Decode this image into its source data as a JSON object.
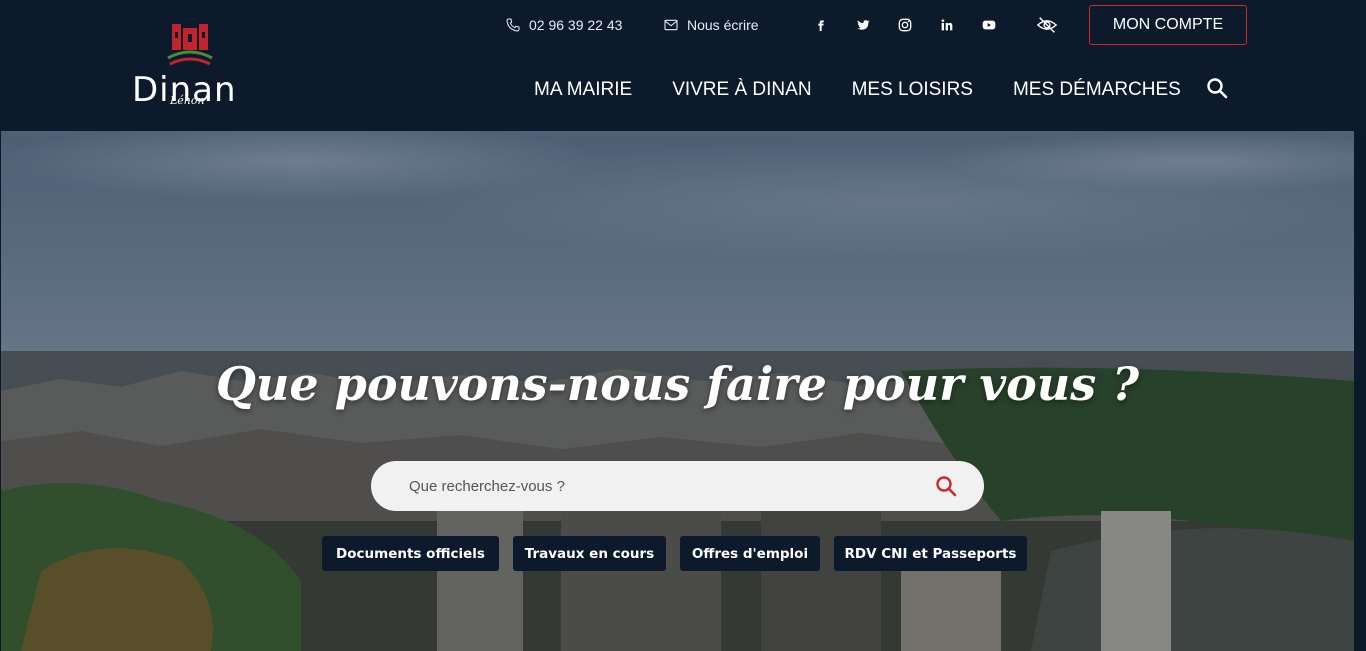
{
  "header": {
    "logo": {
      "name": "Dinan",
      "subtitle": "Léhon"
    },
    "phone": "02 96 39 22 43",
    "contact_label": "Nous écrire",
    "socials": [
      "facebook-icon",
      "twitter-icon",
      "instagram-icon",
      "linkedin-icon",
      "youtube-icon"
    ],
    "account_label": "MON COMPTE",
    "nav": [
      "MA MAIRIE",
      "VIVRE À DINAN",
      "MES LOISIRS",
      "MES DÉMARCHES"
    ]
  },
  "hero": {
    "title": "Que pouvons-nous faire pour vous ?",
    "search_placeholder": "Que recherchez-vous ?",
    "quick_links": [
      "Documents officiels",
      "Travaux en cours",
      "Offres d'emploi",
      "RDV CNI et Passeports"
    ]
  },
  "colors": {
    "header_bg": "#0c1a2b",
    "accent_red": "#d0262f",
    "search_icon": "#c92a2a"
  }
}
